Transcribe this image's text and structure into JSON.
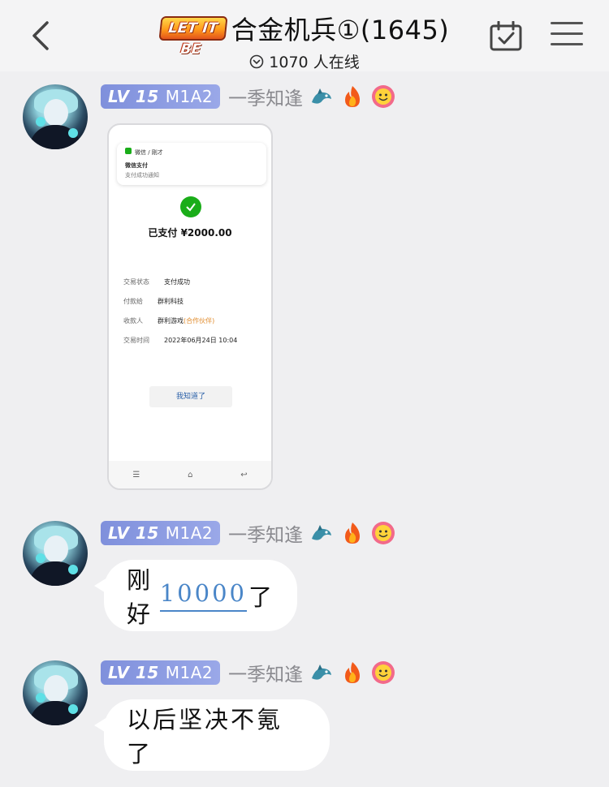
{
  "header": {
    "badge_text": "LET IT BE",
    "group_title": "合金机兵①(1645)",
    "online_text": "1070 人在线",
    "icons": {
      "back": "chevron-left-icon",
      "online": "chevron-down-circle-icon",
      "calendar": "calendar-check-icon",
      "menu": "hamburger-menu-icon"
    }
  },
  "messages": [
    {
      "level": "LV 15",
      "badge_title": "M1A2",
      "username": "一季知逢",
      "emojis": [
        "dragon-emoji",
        "fire-emoji",
        "smiley-flower-emoji"
      ],
      "type": "image",
      "image": {
        "notification_app": "微信 / 刚才",
        "notification_title": "微信支付",
        "notification_sub": "支付成功通知",
        "paid_text": "已支付 ¥2000.00",
        "details": [
          {
            "label": "交易状态",
            "value": "支付成功"
          },
          {
            "label": "付款给",
            "value": "群利科技"
          },
          {
            "label": "收款人",
            "value": "群利游戏",
            "extra": "(合作伙伴)"
          },
          {
            "label": "交易时间",
            "value": "2022年06月24日 10:04"
          }
        ],
        "button_text": "我知道了"
      }
    },
    {
      "level": "LV 15",
      "badge_title": "M1A2",
      "username": "一季知逢",
      "emojis": [
        "dragon-emoji",
        "fire-emoji",
        "smiley-flower-emoji"
      ],
      "type": "text",
      "text_before": "刚好",
      "text_link": "10000",
      "text_after": "了"
    },
    {
      "level": "LV 15",
      "badge_title": "M1A2",
      "username": "一季知逢",
      "emojis": [
        "dragon-emoji",
        "fire-emoji",
        "smiley-flower-emoji"
      ],
      "type": "text",
      "text": "以后坚决不氪了"
    }
  ],
  "colors": {
    "background": "#efeff1",
    "header_bg": "#f4f4f5",
    "level_badge": "#8a9ae2",
    "username": "#8a8a8f",
    "link": "#4a86c8",
    "bubble": "#ffffff"
  }
}
